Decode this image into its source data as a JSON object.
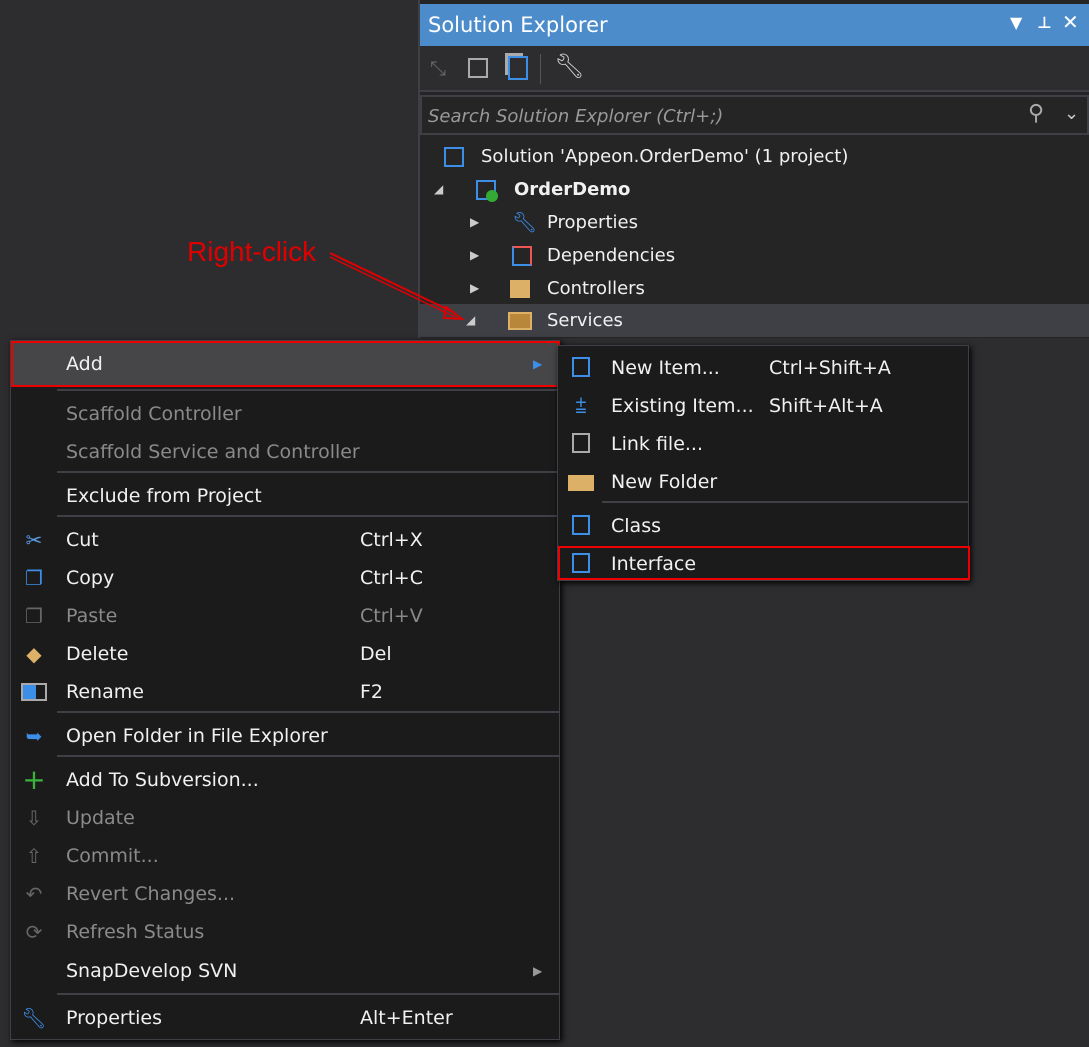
{
  "solution_explorer": {
    "title": "Solution Explorer",
    "title_buttons": [
      "dropdown-icon",
      "pin-icon",
      "close-icon"
    ],
    "toolbar": [
      "sync-icon",
      "collapse-all-icon",
      "show-all-files-icon",
      "properties-wrench-icon"
    ],
    "search_placeholder": "Search Solution Explorer (Ctrl+;)",
    "tree": [
      {
        "label": "Solution 'Appeon.OrderDemo' (1 project)",
        "icon": "solution-icon"
      },
      {
        "label": "OrderDemo",
        "icon": "web-project-icon",
        "expanded": true,
        "bold": true
      },
      {
        "label": "Properties",
        "icon": "wrench-icon",
        "expanded": false
      },
      {
        "label": "Dependencies",
        "icon": "dependencies-icon",
        "expanded": false
      },
      {
        "label": "Controllers",
        "icon": "folder-icon",
        "expanded": false
      },
      {
        "label": "Services",
        "icon": "open-folder-icon",
        "expanded": true,
        "selected": true
      }
    ]
  },
  "annotation": {
    "text": "Right-click",
    "color": "#e00000"
  },
  "context_menu": {
    "items": [
      {
        "label": "Add",
        "submenu": true,
        "highlighted": true
      },
      {
        "label": "Scaffold Controller",
        "disabled": true
      },
      {
        "label": "Scaffold Service and Controller",
        "disabled": true
      },
      {
        "label": "Exclude from Project"
      },
      {
        "label": "Cut",
        "shortcut": "Ctrl+X",
        "icon": "scissors-icon"
      },
      {
        "label": "Copy",
        "shortcut": "Ctrl+C",
        "icon": "copy-icon"
      },
      {
        "label": "Paste",
        "shortcut": "Ctrl+V",
        "icon": "paste-icon",
        "disabled": true
      },
      {
        "label": "Delete",
        "shortcut": "Del",
        "icon": "eraser-icon"
      },
      {
        "label": "Rename",
        "shortcut": "F2",
        "icon": "rename-icon"
      },
      {
        "label": "Open Folder in File Explorer",
        "icon": "open-folder-arrow-icon"
      },
      {
        "label": "Add To Subversion...",
        "icon": "plus-icon"
      },
      {
        "label": "Update",
        "icon": "update-icon",
        "disabled": true
      },
      {
        "label": "Commit...",
        "icon": "commit-icon",
        "disabled": true
      },
      {
        "label": "Revert Changes...",
        "icon": "revert-icon",
        "disabled": true
      },
      {
        "label": "Refresh Status",
        "icon": "refresh-icon",
        "disabled": true
      },
      {
        "label": "SnapDevelop SVN",
        "submenu": true
      },
      {
        "label": "Properties",
        "shortcut": "Alt+Enter",
        "icon": "wrench-icon"
      }
    ]
  },
  "add_submenu": {
    "items": [
      {
        "label": "New Item...",
        "shortcut": "Ctrl+Shift+A",
        "icon": "new-item-icon"
      },
      {
        "label": "Existing Item...",
        "shortcut": "Shift+Alt+A",
        "icon": "existing-item-icon"
      },
      {
        "label": "Link file...",
        "icon": "link-file-icon"
      },
      {
        "label": "New Folder",
        "icon": "new-folder-icon"
      },
      {
        "label": "Class",
        "icon": "class-icon"
      },
      {
        "label": "Interface",
        "icon": "interface-icon",
        "highlighted": true
      }
    ]
  },
  "colors": {
    "title_bar": "#4d8ccb",
    "accent_blue": "#3c8ee6",
    "folder": "#dcb067",
    "highlight_box": "#e00000"
  }
}
